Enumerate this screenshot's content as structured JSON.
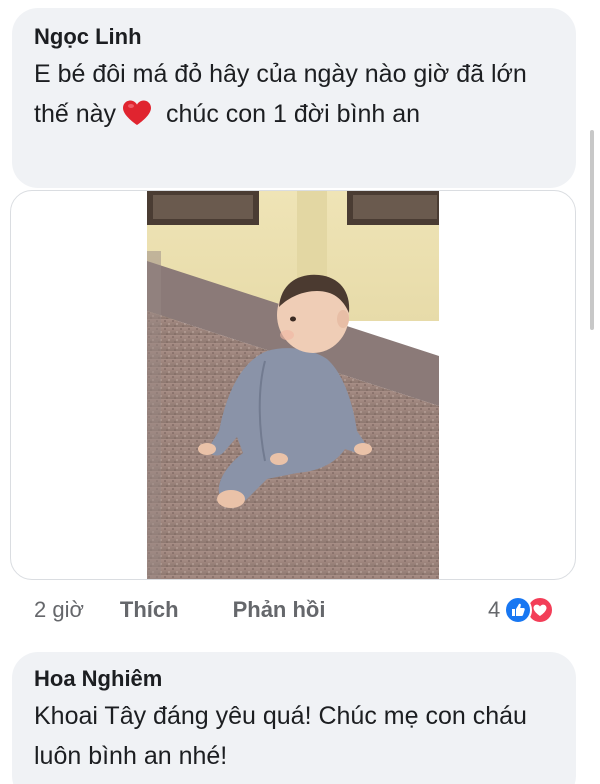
{
  "comments": [
    {
      "author": "Ngọc Linh",
      "text_before_emoji": "E bé đôi má đỏ hây của ngày nào giờ đã lớn thế này",
      "emoji": "red-heart",
      "text_after_emoji": "chúc con 1 đời bình an",
      "time": "2 giờ",
      "like_label": "Thích",
      "reply_label": "Phản hồi",
      "reaction_count": "4",
      "reactions": [
        "like",
        "love"
      ]
    },
    {
      "author": "Hoa Nghiêm",
      "text": "Khoai Tây đáng yêu quá! Chúc mẹ con cháu luôn bình an nhé!"
    }
  ],
  "colors": {
    "bubble": "#f0f2f5",
    "meta_text": "#65676b",
    "like_blue": "#1877f2",
    "love_red": "#f33e58"
  }
}
